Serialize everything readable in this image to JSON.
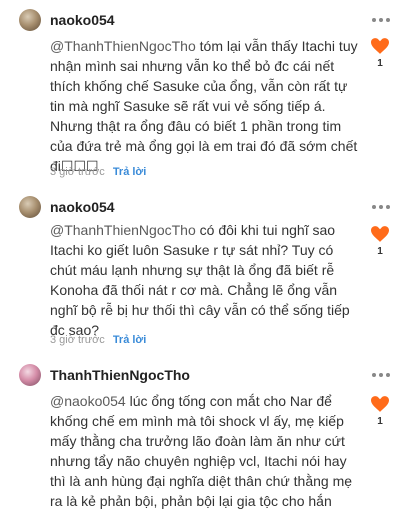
{
  "comments": [
    {
      "username": "naoko054",
      "mention": "@ThanhThienNgocTho",
      "text": " tóm lại vẫn thấy Itachi tuy nhận mình sai nhưng vẫn ko thể bỏ đc cái nết thích khống chế Sasuke của ổng, vẫn còn rất tự tin mà nghĩ Sasuke sẽ rất vui vẻ sống tiếp á. Nhưng thật ra ổng đâu có biết 1 phần trong tim của đứa trẻ mà ổng gọi là em trai đó đã sớm chết đi☐☐☐",
      "time": "3 giờ trước",
      "reply_label": "Trả lời",
      "likes": "1",
      "avatar_icon": "user-avatar-icon"
    },
    {
      "username": "naoko054",
      "mention": "@ThanhThienNgocTho",
      "text": " có đôi khi tui nghĩ sao Itachi ko giết luôn Sasuke r tự sát nhỉ? Tuy có chút máu lạnh nhưng sự thật là ổng đã biết rễ Konoha đã thối nát r cơ mà. Chẳng lẽ ổng vẫn nghĩ bộ rễ bị hư thối thì cây vẫn có thể sống tiếp đc sao?",
      "time": "3 giờ trước",
      "reply_label": "Trả lời",
      "likes": "1",
      "avatar_icon": "user-avatar-icon"
    },
    {
      "username": "ThanhThienNgocTho",
      "mention": "@naoko054",
      "text": " lúc ổng tống con mắt cho Nar để khống chế em mình mà tôi shock vl ấy, mẹ kiếp mấy thằng cha trưởng lão đoàn làm ăn như cứt nhưng tẩy não chuyên nghiệp vcl, Itachi nói hay thì là anh hùng đại nghĩa diệt thân chứ thằng mẹ ra là kẻ phản bội, phản bội lại gia tộc cho hắn",
      "time": "",
      "reply_label": "",
      "likes": "1",
      "avatar_icon": "user-avatar-icon"
    }
  ],
  "colors": {
    "heart": "#ff6b1a",
    "reply": "#3a8bd8"
  }
}
